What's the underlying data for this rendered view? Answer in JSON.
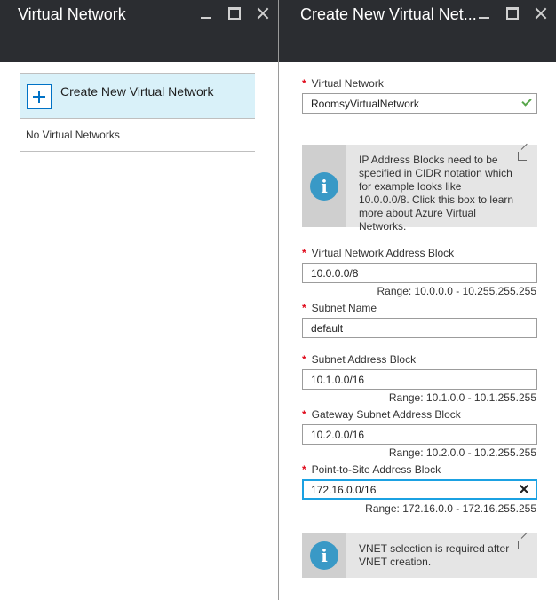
{
  "left_blade": {
    "title": "Virtual Network",
    "create_label": "Create New Virtual Network",
    "empty_label": "No Virtual Networks"
  },
  "right_blade": {
    "title": "Create New Virtual Net...",
    "required_mark": "*",
    "vnet": {
      "label": "Virtual Network",
      "value": "RoomsyVirtualNetwork"
    },
    "info1": "IP Address Blocks need to be specified in CIDR notation which for example looks like 10.0.0.0/8. Click this box to learn more about Azure Virtual Networks.",
    "address_block": {
      "label": "Virtual Network Address Block",
      "value": "10.0.0.0/8",
      "range": "Range: 10.0.0.0 - 10.255.255.255"
    },
    "subnet_name": {
      "label": "Subnet Name",
      "value": "default"
    },
    "subnet_block": {
      "label": "Subnet Address Block",
      "value": "10.1.0.0/16",
      "range": "Range: 10.1.0.0 - 10.1.255.255"
    },
    "gateway_block": {
      "label": "Gateway Subnet Address Block",
      "value": "10.2.0.0/16",
      "range": "Range: 10.2.0.0 - 10.2.255.255"
    },
    "p2s_block": {
      "label": "Point-to-Site Address Block",
      "value": "172.16.0.0/16",
      "range": "Range: 172.16.0.0 - 172.16.255.255"
    },
    "info2": "VNET selection is required after VNET creation.",
    "info_glyph": "i"
  },
  "colors": {
    "header_bg": "#2b2d31",
    "tile_bg": "#d9f1f9",
    "accent": "#0072c6",
    "focus": "#1ba1e2",
    "required": "#e00b1c",
    "valid": "#57a64a",
    "info_icon": "#3999c6"
  },
  "icons": [
    "minimize-icon",
    "maximize-icon",
    "close-icon",
    "plus-icon",
    "check-icon",
    "clear-icon",
    "info-icon",
    "external-link-icon"
  ]
}
